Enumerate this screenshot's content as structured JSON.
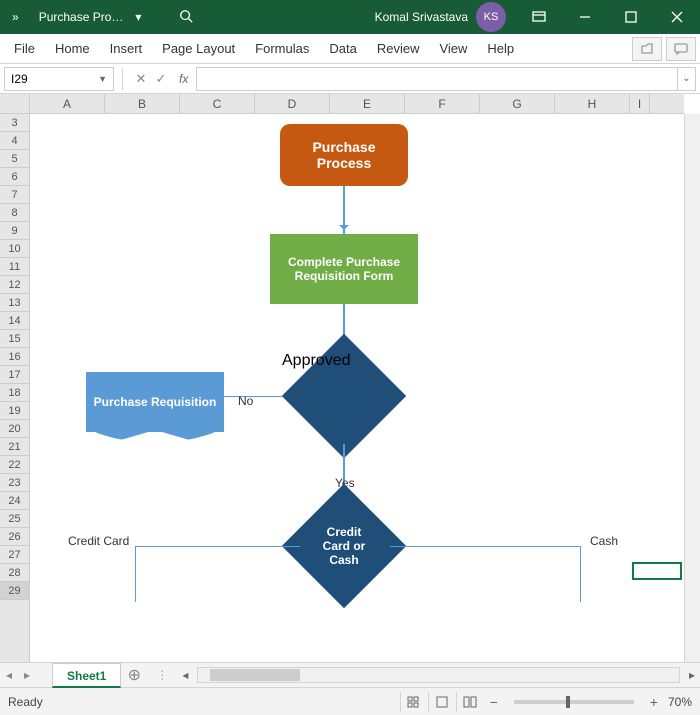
{
  "title": {
    "doc": "Purchase Pro…",
    "user": "Komal Srivastava",
    "initials": "KS"
  },
  "ribbon": {
    "tabs": [
      "File",
      "Home",
      "Insert",
      "Page Layout",
      "Formulas",
      "Data",
      "Review",
      "View",
      "Help"
    ]
  },
  "formula": {
    "cellref": "I29",
    "value": ""
  },
  "cols": [
    "A",
    "B",
    "C",
    "D",
    "E",
    "F",
    "G",
    "H",
    "I"
  ],
  "rows": [
    "3",
    "4",
    "5",
    "6",
    "7",
    "8",
    "9",
    "10",
    "11",
    "12",
    "13",
    "14",
    "15",
    "16",
    "17",
    "18",
    "19",
    "20",
    "21",
    "22",
    "23",
    "24",
    "25",
    "26",
    "27",
    "28",
    "29"
  ],
  "flow": {
    "s1": "Purchase Process",
    "s2": "Complete Purchase Requisition Form",
    "d1": "Approved",
    "d2": "Credit Card or Cash",
    "doc": "Purchase Requisition",
    "no": "No",
    "yes": "Yes",
    "cc": "Credit Card",
    "cash": "Cash"
  },
  "sheet": "Sheet1",
  "status": {
    "ready": "Ready",
    "zoom": "70%"
  }
}
